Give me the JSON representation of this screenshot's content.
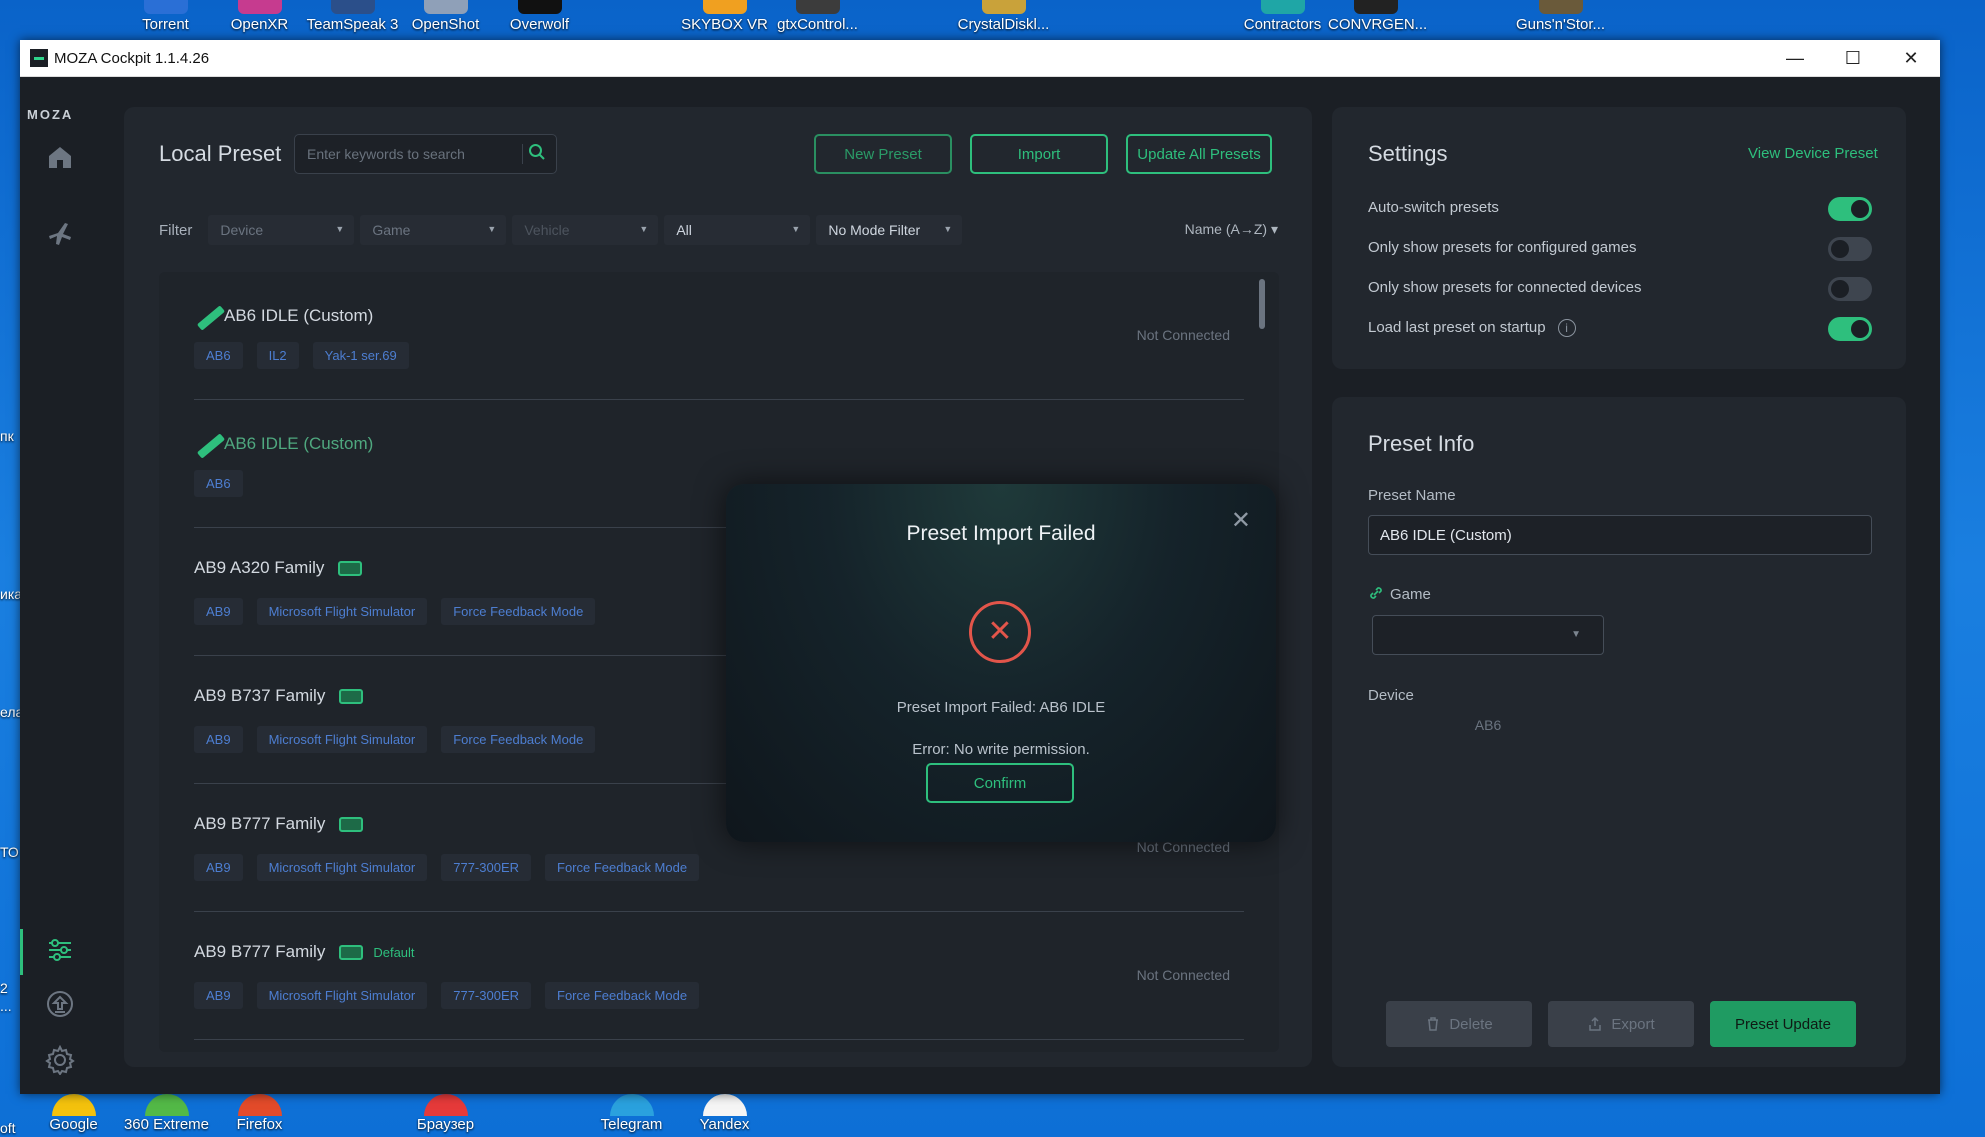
{
  "desktop": {
    "top_icons": [
      {
        "label": "Torrent",
        "color": "#2a6fd6"
      },
      {
        "label": "OpenXR",
        "color": "#c63b8f"
      },
      {
        "label": "TeamSpeak 3",
        "color": "#2b4f8a"
      },
      {
        "label": "OpenShot",
        "color": "#8fa0b8"
      },
      {
        "label": "Overwolf",
        "color": "#111111"
      },
      {
        "label": "SKYBOX VR",
        "color": "#f0a020"
      },
      {
        "label": "gtxControl...",
        "color": "#3c3c3c"
      },
      {
        "label": "CrystalDiskl...",
        "color": "#c9a23a"
      },
      {
        "label": "Contractors",
        "color": "#1fa6a6"
      },
      {
        "label": "CONVRGEN...",
        "color": "#222222"
      },
      {
        "label": "Guns'n'Stor...",
        "color": "#6a5a3a"
      }
    ],
    "bottom_icons": [
      {
        "label": "Google",
        "color": "#f4c20d"
      },
      {
        "label": "360 Extreme",
        "color": "#53b947"
      },
      {
        "label": "Firefox",
        "color": "#e34b2a"
      },
      {
        "label": "Браузер",
        "color": "#e63a3a"
      },
      {
        "label": "Telegram",
        "color": "#2aa1de"
      },
      {
        "label": "Yandex",
        "color": "#f5f5f5"
      }
    ],
    "left_fragments": [
      "пк",
      "ика",
      "ела",
      "ТО",
      "2",
      "...",
      "oft"
    ]
  },
  "window": {
    "title": "MOZA Cockpit 1.1.4.26",
    "minimize": "—",
    "maximize": "☐",
    "close": "✕"
  },
  "sidenav": {
    "logo": "MOZA"
  },
  "local_preset": {
    "title": "Local Preset",
    "search_placeholder": "Enter keywords to search",
    "new_preset": "New Preset",
    "import": "Import",
    "update_all": "Update All Presets",
    "filter_label": "Filter",
    "filters": [
      "Device",
      "Game",
      "Vehicle",
      "All",
      "No Mode Filter"
    ],
    "sort": "Name (A→Z) ▾",
    "presets": [
      {
        "name": "AB6 IDLE (Custom)",
        "tags": [
          "AB6",
          "IL2",
          "Yak-1 ser.69"
        ],
        "status": "Not Connected"
      },
      {
        "name": "AB6 IDLE (Custom)",
        "tags": [
          "AB6"
        ],
        "status": ""
      },
      {
        "name": "AB9 A320 Family",
        "tags": [
          "AB9",
          "Microsoft Flight Simulator",
          "Force Feedback Mode"
        ],
        "status": ""
      },
      {
        "name": "AB9 B737 Family",
        "tags": [
          "AB9",
          "Microsoft Flight Simulator",
          "Force Feedback Mode"
        ],
        "status": ""
      },
      {
        "name": "AB9 B777 Family",
        "tags": [
          "AB9",
          "Microsoft Flight Simulator",
          "777-300ER",
          "Force Feedback Mode"
        ],
        "status": "Not Connected"
      },
      {
        "name": "AB9 B777 Family",
        "default": "Default",
        "tags": [
          "AB9",
          "Microsoft Flight Simulator",
          "777-300ER",
          "Force Feedback Mode"
        ],
        "status": "Not Connected"
      }
    ]
  },
  "settings": {
    "title": "Settings",
    "view_device": "View Device Preset",
    "options": [
      {
        "label": "Auto-switch presets",
        "on": true
      },
      {
        "label": "Only show presets for configured games",
        "on": false
      },
      {
        "label": "Only show presets for connected devices",
        "on": false
      },
      {
        "label": "Load last preset on startup",
        "on": true
      }
    ]
  },
  "preset_info": {
    "title": "Preset Info",
    "name_label": "Preset Name",
    "name_value": "AB6 IDLE (Custom)",
    "game_label": "Game",
    "device_label": "Device",
    "device_value": "AB6",
    "delete": "Delete",
    "export": "Export",
    "update": "Preset Update"
  },
  "modal": {
    "title": "Preset Import Failed",
    "message": "Preset Import Failed: AB6 IDLE",
    "error": "Error: No write permission.",
    "confirm": "Confirm"
  },
  "colors": {
    "accent": "#2ebf7d",
    "error": "#e2554a",
    "tag_text": "#4d7ed1"
  }
}
